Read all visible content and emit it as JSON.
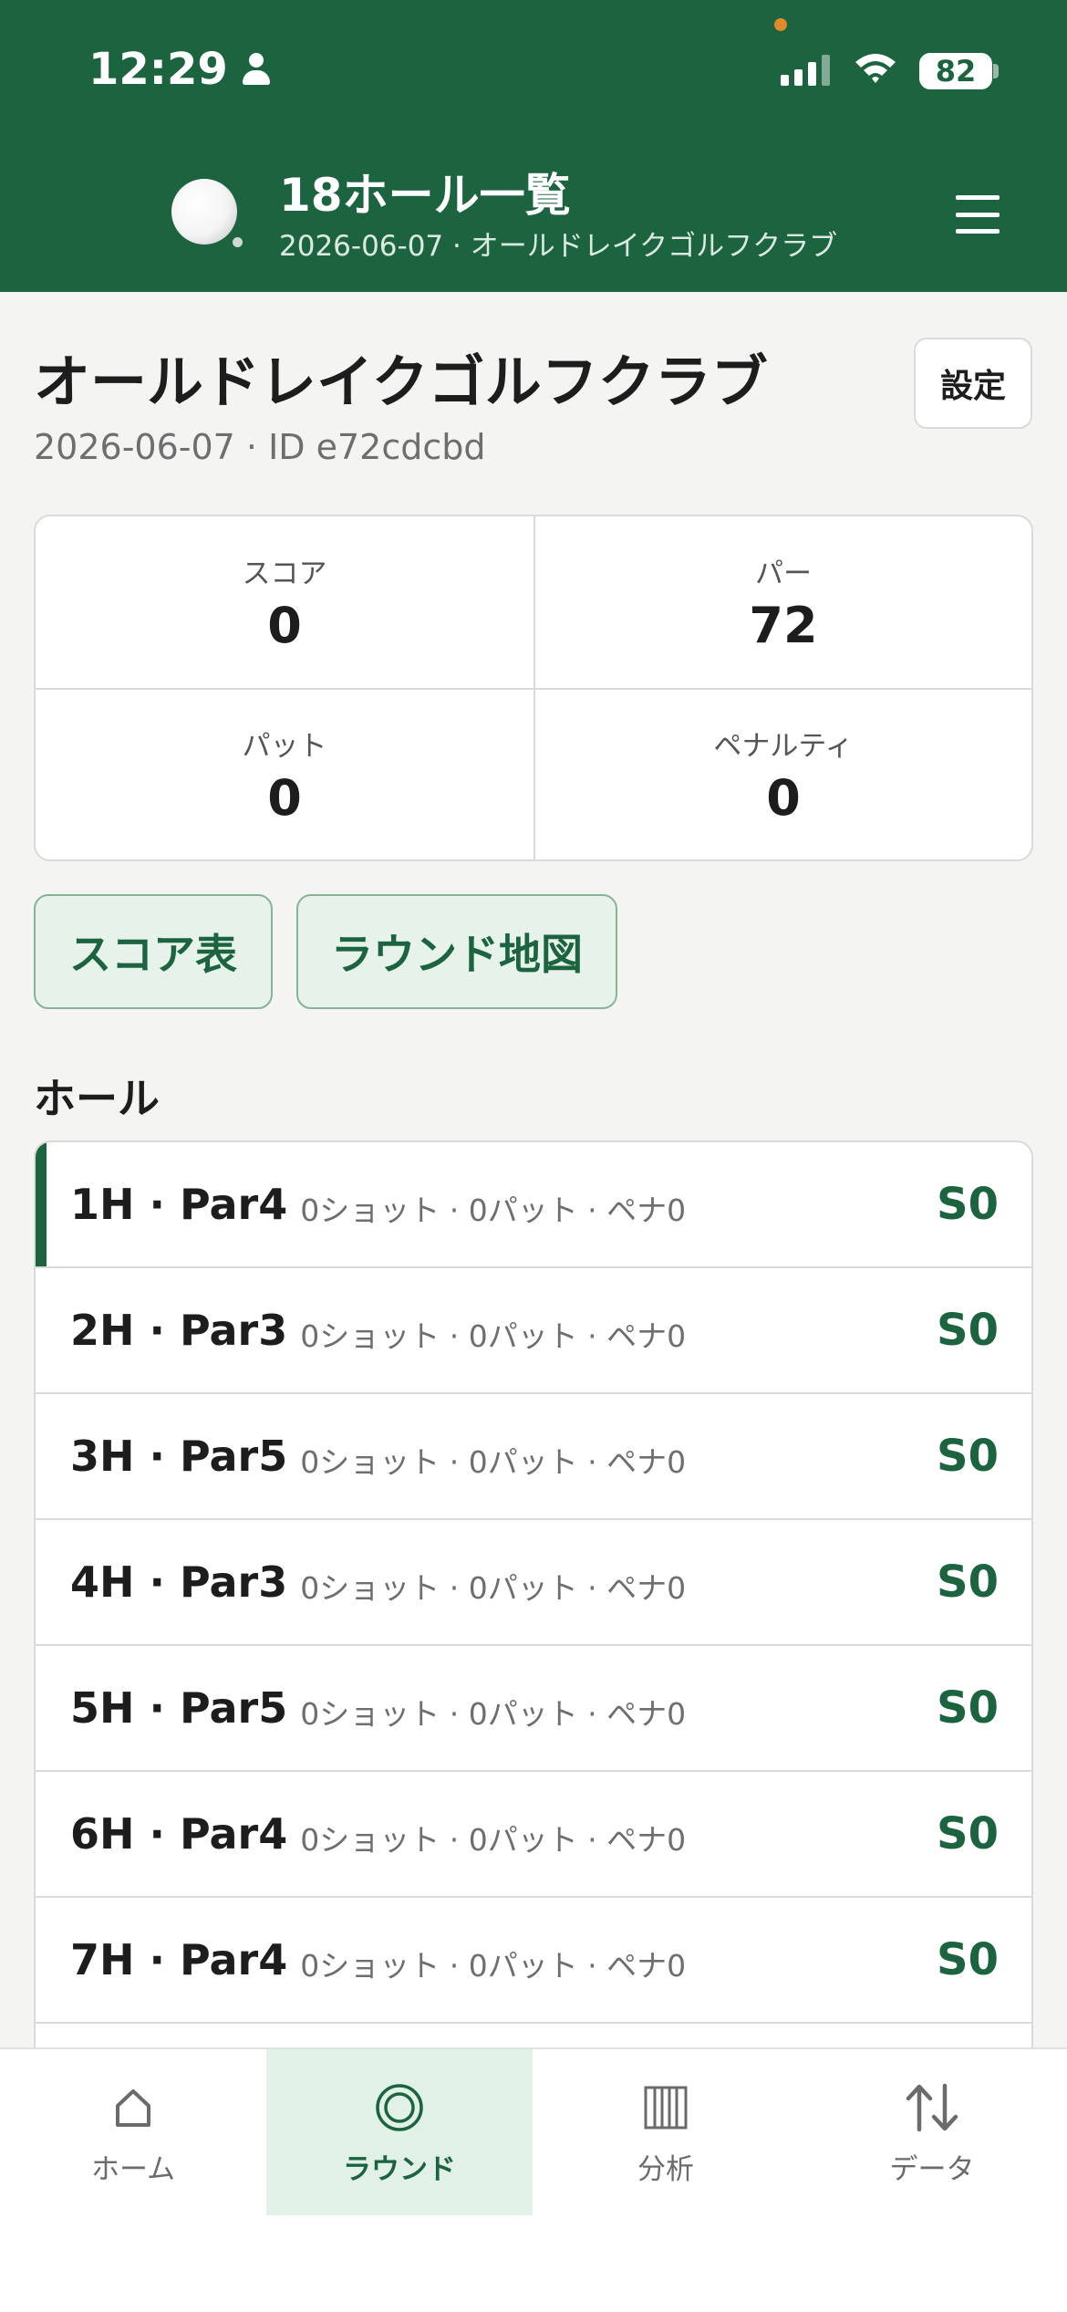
{
  "status_bar": {
    "time": "12:29",
    "battery": "82"
  },
  "header": {
    "title": "18ホール一覧",
    "subtitle": "2026-06-07 · オールドレイクゴルフクラブ"
  },
  "round": {
    "course_name": "オールドレイクゴルフクラブ",
    "meta": "2026-06-07 · ID e72cdcbd",
    "settings_label": "設定"
  },
  "stats": [
    {
      "label": "スコア",
      "value": "0"
    },
    {
      "label": "パー",
      "value": "72"
    },
    {
      "label": "パット",
      "value": "0"
    },
    {
      "label": "ペナルティ",
      "value": "0"
    }
  ],
  "actions": {
    "scorecard": "スコア表",
    "round_map": "ラウンド地図"
  },
  "holes_section": {
    "title": "ホール"
  },
  "holes": [
    {
      "title": "1H · Par4",
      "detail": "0ショット · 0パット · ペナ0",
      "score": "S0"
    },
    {
      "title": "2H · Par3",
      "detail": "0ショット · 0パット · ペナ0",
      "score": "S0"
    },
    {
      "title": "3H · Par5",
      "detail": "0ショット · 0パット · ペナ0",
      "score": "S0"
    },
    {
      "title": "4H · Par3",
      "detail": "0ショット · 0パット · ペナ0",
      "score": "S0"
    },
    {
      "title": "5H · Par5",
      "detail": "0ショット · 0パット · ペナ0",
      "score": "S0"
    },
    {
      "title": "6H · Par4",
      "detail": "0ショット · 0パット · ペナ0",
      "score": "S0"
    },
    {
      "title": "7H · Par4",
      "detail": "0ショット · 0パット · ペナ0",
      "score": "S0"
    }
  ],
  "nav": [
    {
      "label": "ホーム",
      "icon": "home-icon"
    },
    {
      "label": "ラウンド",
      "icon": "target-icon"
    },
    {
      "label": "分析",
      "icon": "chart-bars-icon"
    },
    {
      "label": "データ",
      "icon": "transfer-arrows-icon"
    }
  ],
  "colors": {
    "brand": "#1c6440",
    "accent_bg": "#e6f2ea",
    "background": "#f4f5f3"
  }
}
